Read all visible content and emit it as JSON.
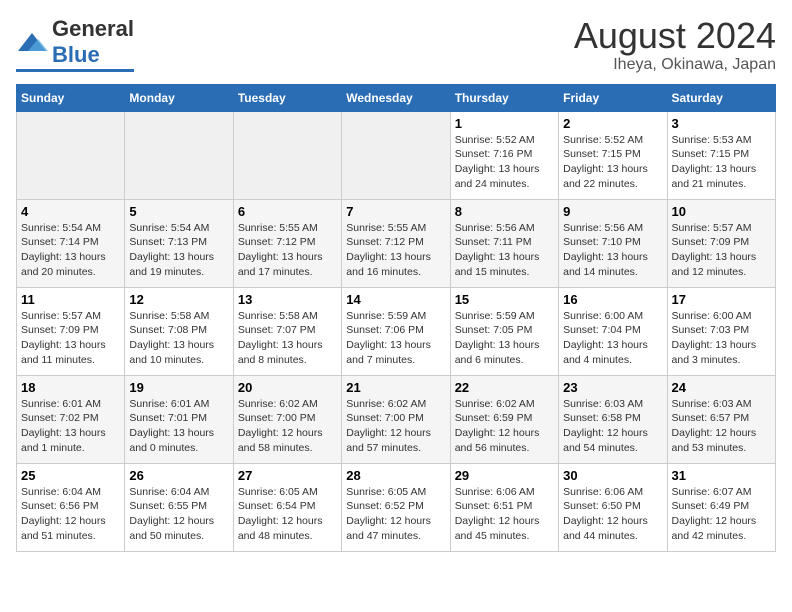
{
  "header": {
    "logo_general": "General",
    "logo_blue": "Blue",
    "title": "August 2024",
    "subtitle": "Iheya, Okinawa, Japan"
  },
  "weekdays": [
    "Sunday",
    "Monday",
    "Tuesday",
    "Wednesday",
    "Thursday",
    "Friday",
    "Saturday"
  ],
  "weeks": [
    [
      {
        "day": "",
        "info": ""
      },
      {
        "day": "",
        "info": ""
      },
      {
        "day": "",
        "info": ""
      },
      {
        "day": "",
        "info": ""
      },
      {
        "day": "1",
        "info": "Sunrise: 5:52 AM\nSunset: 7:16 PM\nDaylight: 13 hours\nand 24 minutes."
      },
      {
        "day": "2",
        "info": "Sunrise: 5:52 AM\nSunset: 7:15 PM\nDaylight: 13 hours\nand 22 minutes."
      },
      {
        "day": "3",
        "info": "Sunrise: 5:53 AM\nSunset: 7:15 PM\nDaylight: 13 hours\nand 21 minutes."
      }
    ],
    [
      {
        "day": "4",
        "info": "Sunrise: 5:54 AM\nSunset: 7:14 PM\nDaylight: 13 hours\nand 20 minutes."
      },
      {
        "day": "5",
        "info": "Sunrise: 5:54 AM\nSunset: 7:13 PM\nDaylight: 13 hours\nand 19 minutes."
      },
      {
        "day": "6",
        "info": "Sunrise: 5:55 AM\nSunset: 7:12 PM\nDaylight: 13 hours\nand 17 minutes."
      },
      {
        "day": "7",
        "info": "Sunrise: 5:55 AM\nSunset: 7:12 PM\nDaylight: 13 hours\nand 16 minutes."
      },
      {
        "day": "8",
        "info": "Sunrise: 5:56 AM\nSunset: 7:11 PM\nDaylight: 13 hours\nand 15 minutes."
      },
      {
        "day": "9",
        "info": "Sunrise: 5:56 AM\nSunset: 7:10 PM\nDaylight: 13 hours\nand 14 minutes."
      },
      {
        "day": "10",
        "info": "Sunrise: 5:57 AM\nSunset: 7:09 PM\nDaylight: 13 hours\nand 12 minutes."
      }
    ],
    [
      {
        "day": "11",
        "info": "Sunrise: 5:57 AM\nSunset: 7:09 PM\nDaylight: 13 hours\nand 11 minutes."
      },
      {
        "day": "12",
        "info": "Sunrise: 5:58 AM\nSunset: 7:08 PM\nDaylight: 13 hours\nand 10 minutes."
      },
      {
        "day": "13",
        "info": "Sunrise: 5:58 AM\nSunset: 7:07 PM\nDaylight: 13 hours\nand 8 minutes."
      },
      {
        "day": "14",
        "info": "Sunrise: 5:59 AM\nSunset: 7:06 PM\nDaylight: 13 hours\nand 7 minutes."
      },
      {
        "day": "15",
        "info": "Sunrise: 5:59 AM\nSunset: 7:05 PM\nDaylight: 13 hours\nand 6 minutes."
      },
      {
        "day": "16",
        "info": "Sunrise: 6:00 AM\nSunset: 7:04 PM\nDaylight: 13 hours\nand 4 minutes."
      },
      {
        "day": "17",
        "info": "Sunrise: 6:00 AM\nSunset: 7:03 PM\nDaylight: 13 hours\nand 3 minutes."
      }
    ],
    [
      {
        "day": "18",
        "info": "Sunrise: 6:01 AM\nSunset: 7:02 PM\nDaylight: 13 hours\nand 1 minute."
      },
      {
        "day": "19",
        "info": "Sunrise: 6:01 AM\nSunset: 7:01 PM\nDaylight: 13 hours\nand 0 minutes."
      },
      {
        "day": "20",
        "info": "Sunrise: 6:02 AM\nSunset: 7:00 PM\nDaylight: 12 hours\nand 58 minutes."
      },
      {
        "day": "21",
        "info": "Sunrise: 6:02 AM\nSunset: 7:00 PM\nDaylight: 12 hours\nand 57 minutes."
      },
      {
        "day": "22",
        "info": "Sunrise: 6:02 AM\nSunset: 6:59 PM\nDaylight: 12 hours\nand 56 minutes."
      },
      {
        "day": "23",
        "info": "Sunrise: 6:03 AM\nSunset: 6:58 PM\nDaylight: 12 hours\nand 54 minutes."
      },
      {
        "day": "24",
        "info": "Sunrise: 6:03 AM\nSunset: 6:57 PM\nDaylight: 12 hours\nand 53 minutes."
      }
    ],
    [
      {
        "day": "25",
        "info": "Sunrise: 6:04 AM\nSunset: 6:56 PM\nDaylight: 12 hours\nand 51 minutes."
      },
      {
        "day": "26",
        "info": "Sunrise: 6:04 AM\nSunset: 6:55 PM\nDaylight: 12 hours\nand 50 minutes."
      },
      {
        "day": "27",
        "info": "Sunrise: 6:05 AM\nSunset: 6:54 PM\nDaylight: 12 hours\nand 48 minutes."
      },
      {
        "day": "28",
        "info": "Sunrise: 6:05 AM\nSunset: 6:52 PM\nDaylight: 12 hours\nand 47 minutes."
      },
      {
        "day": "29",
        "info": "Sunrise: 6:06 AM\nSunset: 6:51 PM\nDaylight: 12 hours\nand 45 minutes."
      },
      {
        "day": "30",
        "info": "Sunrise: 6:06 AM\nSunset: 6:50 PM\nDaylight: 12 hours\nand 44 minutes."
      },
      {
        "day": "31",
        "info": "Sunrise: 6:07 AM\nSunset: 6:49 PM\nDaylight: 12 hours\nand 42 minutes."
      }
    ]
  ]
}
